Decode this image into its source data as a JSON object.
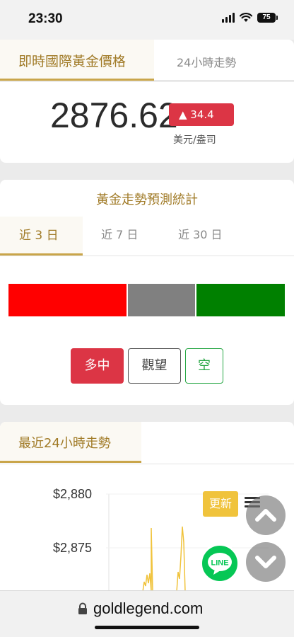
{
  "status_bar": {
    "time": "23:30",
    "battery": "75"
  },
  "price_tabs": {
    "active": "即時國際黃金價格",
    "other": "24小時走勢"
  },
  "price": {
    "value": "2876.62",
    "change": "▲ 34.4",
    "unit": "美元/盎司"
  },
  "forecast": {
    "title": "黃金走勢預測統計",
    "tabs": [
      "近 3 日",
      "近 7 日",
      "近 30 日"
    ],
    "active_tab": "近 3 日",
    "buttons": {
      "bull": "多中",
      "watch": "觀望",
      "bear": "空"
    },
    "colors": {
      "bull": "#ff0000",
      "neutral": "#808080",
      "bear": "#008000"
    }
  },
  "trend": {
    "title": "最近24小時走勢",
    "y_ticks": [
      "$2,880",
      "$2,875"
    ],
    "update_label": "更新",
    "line_label": "LINE",
    "line_color": "#f0c33c"
  },
  "browser": {
    "url": "goldlegend.com"
  }
}
